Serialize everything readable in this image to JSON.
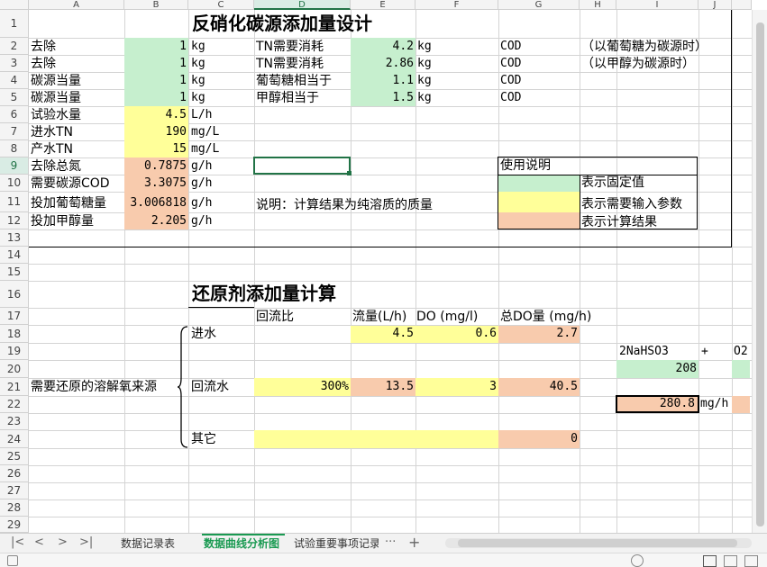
{
  "columns": [
    "A",
    "B",
    "C",
    "D",
    "E",
    "F",
    "G",
    "H",
    "I",
    "J"
  ],
  "rows": [
    "1",
    "2",
    "3",
    "4",
    "5",
    "6",
    "7",
    "8",
    "9",
    "10",
    "11",
    "12",
    "13",
    "14",
    "15",
    "16",
    "17",
    "18",
    "19",
    "20",
    "21",
    "22",
    "23",
    "24",
    "25",
    "26",
    "27",
    "28",
    "29"
  ],
  "selected_column": "D",
  "selected_row": "9",
  "section1": {
    "title": "反硝化碳源添加量设计",
    "rows": [
      {
        "a": "去除",
        "b": "1",
        "c": "kg",
        "d": "TN需要消耗",
        "e": "4.2",
        "f": "kg",
        "g": "COD",
        "note": "（以葡萄糖为碳源时）"
      },
      {
        "a": "去除",
        "b": "1",
        "c": "kg",
        "d": "TN需要消耗",
        "e": "2.86",
        "f": "kg",
        "g": "COD",
        "note": "（以甲醇为碳源时）"
      },
      {
        "a": "碳源当量",
        "b": "1",
        "c": "kg",
        "d": "葡萄糖相当于",
        "e": "1.1",
        "f": "kg",
        "g": "COD"
      },
      {
        "a": "碳源当量",
        "b": "1",
        "c": "kg",
        "d": "甲醇相当于",
        "e": "1.5",
        "f": "kg",
        "g": "COD"
      },
      {
        "a": "试验水量",
        "b": "4.5",
        "c": "L/h"
      },
      {
        "a": "进水TN",
        "b": "190",
        "c": "mg/L"
      },
      {
        "a": "产水TN",
        "b": "15",
        "c": "mg/L"
      },
      {
        "a": "去除总氮",
        "b": "0.7875",
        "c": "g/h"
      },
      {
        "a": "需要碳源COD",
        "b": "3.3075",
        "c": "g/h"
      },
      {
        "a": "投加葡萄糖量",
        "b": "3.006818",
        "c": "g/h"
      },
      {
        "a": "投加甲醇量",
        "b": "2.205",
        "c": "g/h"
      }
    ],
    "note": "说明：计算结果为纯溶质的质量",
    "legend": {
      "title": "使用说明",
      "items": [
        "表示固定值",
        "表示需要输入参数",
        "表示计算结果"
      ]
    }
  },
  "section2": {
    "title": "还原剂添加量计算",
    "headers": [
      "回流比",
      "流量(L/h)",
      "DO (mg/l)",
      "总DO量 (mg/h)"
    ],
    "brace_label": "需要还原的溶解氧来源",
    "influent": {
      "label": "进水",
      "flow": "4.5",
      "do": "0.6",
      "total": "2.7"
    },
    "reflux": {
      "label": "回流水",
      "ratio": "300%",
      "flow": "13.5",
      "do": "3",
      "total": "40.5"
    },
    "other": {
      "label": "其它",
      "total": "0"
    },
    "formula": {
      "reagent": "2NaHSO3",
      "plus": "+",
      "o2": "O2",
      "mw": "208",
      "result": "280.8",
      "unit": "mg/h"
    }
  },
  "sheet_tabs": [
    "数据记录表",
    "数据曲线分析图",
    "试验重要事项记录"
  ],
  "active_tab": "数据曲线分析图",
  "tab_more": "···",
  "tab_add": "+",
  "nav_buttons": [
    "|<",
    "<",
    ">",
    ">|"
  ],
  "colors": {
    "fixed": "#c6efce",
    "input": "#ffff99",
    "result": "#f8cbad",
    "accent": "#217346"
  }
}
